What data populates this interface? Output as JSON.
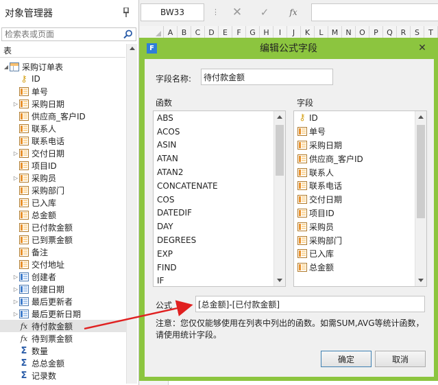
{
  "left_panel": {
    "title": "对象管理器",
    "pin_icon": "pin-icon",
    "search_placeholder": "检索表或页面",
    "section_label": "表",
    "tree": [
      {
        "label": "采购订单表",
        "icon": "table-icon",
        "toggle": "◢",
        "indent": 1
      },
      {
        "label": "ID",
        "icon": "key-icon",
        "toggle": "",
        "indent": 2
      },
      {
        "label": "单号",
        "icon": "column-icon",
        "toggle": "",
        "indent": 2
      },
      {
        "label": "采购日期",
        "icon": "column-icon",
        "toggle": "▷",
        "indent": 2
      },
      {
        "label": "供应商_客户ID",
        "icon": "column-icon",
        "toggle": "",
        "indent": 2
      },
      {
        "label": "联系人",
        "icon": "column-icon",
        "toggle": "",
        "indent": 2
      },
      {
        "label": "联系电话",
        "icon": "column-icon",
        "toggle": "",
        "indent": 2
      },
      {
        "label": "交付日期",
        "icon": "column-icon",
        "toggle": "▷",
        "indent": 2
      },
      {
        "label": "项目ID",
        "icon": "column-icon",
        "toggle": "",
        "indent": 2
      },
      {
        "label": "采购员",
        "icon": "column-icon",
        "toggle": "▷",
        "indent": 2
      },
      {
        "label": "采购部门",
        "icon": "column-icon",
        "toggle": "",
        "indent": 2
      },
      {
        "label": "已入库",
        "icon": "column-icon",
        "toggle": "",
        "indent": 2
      },
      {
        "label": "总金额",
        "icon": "column-icon",
        "toggle": "",
        "indent": 2
      },
      {
        "label": "已付款金额",
        "icon": "column-icon",
        "toggle": "",
        "indent": 2
      },
      {
        "label": "已到票金额",
        "icon": "column-icon",
        "toggle": "",
        "indent": 2
      },
      {
        "label": "备注",
        "icon": "column-icon",
        "toggle": "",
        "indent": 2
      },
      {
        "label": "交付地址",
        "icon": "column-icon",
        "toggle": "",
        "indent": 2
      },
      {
        "label": "创建者",
        "icon": "blue-column-icon",
        "toggle": "▷",
        "indent": 2
      },
      {
        "label": "创建日期",
        "icon": "blue-column-icon",
        "toggle": "▷",
        "indent": 2
      },
      {
        "label": "最后更新者",
        "icon": "blue-column-icon",
        "toggle": "▷",
        "indent": 2
      },
      {
        "label": "最后更新日期",
        "icon": "blue-column-icon",
        "toggle": "▷",
        "indent": 2
      },
      {
        "label": "待付款金额",
        "icon": "fx-icon",
        "toggle": "",
        "indent": 2,
        "selected": true
      },
      {
        "label": "待到票金额",
        "icon": "fx-icon",
        "toggle": "",
        "indent": 2
      },
      {
        "label": "数量",
        "icon": "sigma-icon",
        "toggle": "",
        "indent": 2
      },
      {
        "label": "总总金额",
        "icon": "sigma-icon",
        "toggle": "",
        "indent": 2
      },
      {
        "label": "记录数",
        "icon": "sigma-icon",
        "toggle": "",
        "indent": 2
      }
    ]
  },
  "toolbar": {
    "cell_ref": "BW33",
    "cancel_glyph": "✕",
    "confirm_glyph": "✓",
    "fx_label": "fx",
    "formula_value": ""
  },
  "grid": {
    "columns": [
      "A",
      "B",
      "C",
      "D",
      "E",
      "F",
      "G",
      "H",
      "I",
      "J",
      "K",
      "L",
      "M",
      "N",
      "O",
      "P",
      "Q",
      "R",
      "S",
      "T"
    ]
  },
  "dialog": {
    "title": "编辑公式字段",
    "app_icon_letter": "F",
    "close_glyph": "✕",
    "field_name_label": "字段名称:",
    "field_name_value": "待付款金额",
    "functions_label": "函数",
    "functions": [
      "ABS",
      "ACOS",
      "ASIN",
      "ATAN",
      "ATAN2",
      "CONCATENATE",
      "COS",
      "DATEDIF",
      "DAY",
      "DEGREES",
      "EXP",
      "FIND",
      "IF"
    ],
    "fields_label": "字段",
    "fields": [
      {
        "label": "ID",
        "icon": "key-icon"
      },
      {
        "label": "单号",
        "icon": "column-icon"
      },
      {
        "label": "采购日期",
        "icon": "column-icon"
      },
      {
        "label": "供应商_客户ID",
        "icon": "column-icon"
      },
      {
        "label": "联系人",
        "icon": "column-icon"
      },
      {
        "label": "联系电话",
        "icon": "column-icon"
      },
      {
        "label": "交付日期",
        "icon": "column-icon"
      },
      {
        "label": "项目ID",
        "icon": "column-icon"
      },
      {
        "label": "采购员",
        "icon": "column-icon"
      },
      {
        "label": "采购部门",
        "icon": "column-icon"
      },
      {
        "label": "已入库",
        "icon": "column-icon"
      },
      {
        "label": "总金额",
        "icon": "column-icon"
      }
    ],
    "formula_label": "公式",
    "formula_value": "[总金额]-[已付款金额]",
    "note": "注意：您仅仅能够使用在列表中列出的函数。如需SUM,AVG等统计函数，请使用统计字段。",
    "ok_label": "确定",
    "cancel_label": "取消",
    "frame_color": "#8cc53f"
  },
  "annotation": {
    "arrow_color": "#e02020"
  }
}
